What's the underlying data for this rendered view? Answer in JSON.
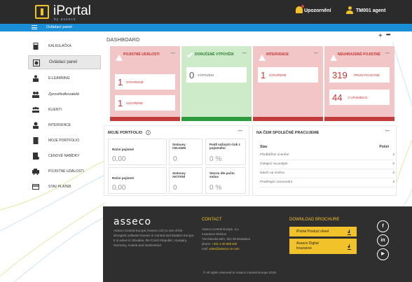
{
  "header": {
    "app_name": "iPortal",
    "brand_sub": "by asseco",
    "notifications_label": "Upozornění",
    "user_label": "TM001 agent"
  },
  "breadcrumb": {
    "current": "Ovládací panel"
  },
  "sidebar": {
    "items": [
      {
        "label": "KALKULAČKA",
        "icon": "calculator-icon"
      },
      {
        "label": "Ovládací panel",
        "icon": "dashboard-icon",
        "active": true
      },
      {
        "label": "E-LEARNING",
        "icon": "elearning-icon"
      },
      {
        "label": "Zprostředkovatelé",
        "icon": "intermediaries-icon"
      },
      {
        "label": "KLIENTI",
        "icon": "clients-icon"
      },
      {
        "label": "INTERVENCE",
        "icon": "intervention-icon"
      },
      {
        "label": "MOJE PORTFOLIO",
        "icon": "portfolio-icon"
      },
      {
        "label": "CENOVÉ NABÍDKY",
        "icon": "quotes-icon"
      },
      {
        "label": "POJISTNÉ UDÁLOSTI",
        "icon": "claims-icon"
      },
      {
        "label": "STAV PLATEB",
        "icon": "payments-icon"
      }
    ]
  },
  "dashboard": {
    "title": "DASHBOARD",
    "add_symbol": "+",
    "more_symbol": "•••"
  },
  "cards": [
    {
      "title": "POJISTNÉ UDÁLOSTI",
      "status": "warning",
      "color": "#f2c6c6",
      "bar_color": "#c43b3b",
      "rows": [
        {
          "count": "1",
          "label": "OTEVŘENÉ"
        },
        {
          "count": "1",
          "label": "UZAVŘENÉ"
        }
      ]
    },
    {
      "title": "DORUČENÉ VÝPOVĚDI",
      "status": "ok",
      "color": "#cdebc8",
      "bar_color": "#2e9b3e",
      "rows": [
        {
          "count": "0",
          "label": "VÝPOVĚDI"
        }
      ]
    },
    {
      "title": "INTERVENCE",
      "status": "warning",
      "color": "#f2c6c6",
      "bar_color": "#c43b3b",
      "rows": [
        {
          "count": "1",
          "label": "OTEVŘENÉ"
        }
      ]
    },
    {
      "title": "NEUHRAZENÉ POJISTNÉ",
      "status": "warning",
      "color": "#f2c6c6",
      "bar_color": "#c43b3b",
      "rows": [
        {
          "count": "319",
          "label": "PRVNÍ POJISTNÉ"
        },
        {
          "count": "44",
          "label": "V UPOMÍNCE"
        }
      ]
    }
  ],
  "portfolio": {
    "title": "MOJE PORTFOLIO",
    "boxes": [
      {
        "label": "Roční pojistné",
        "value": "0,00"
      },
      {
        "label": "Smlouvy CELKEM",
        "value": "0"
      },
      {
        "label": "Podíl vážných rizik z pojistného",
        "value": "0 %"
      },
      {
        "label": "Roční pojistné",
        "value": "0,00"
      },
      {
        "label": "Smlouvy AKTIVNÍ",
        "value": "0"
      },
      {
        "label": "Storno dle počtu smluv",
        "value": "0 %"
      }
    ]
  },
  "shared_work": {
    "title": "NA ČEM SPOLEČNĚ PRACUJEME",
    "col_state": "Stav",
    "col_count": "Počet",
    "rows": [
      {
        "label": "Předběžné ocenění",
        "count": "2"
      },
      {
        "label": "Čekající na podpis",
        "count": "0"
      },
      {
        "label": "Návrh na změnu",
        "count": "2"
      },
      {
        "label": "Prolehající ocenování",
        "count": "3"
      }
    ]
  },
  "footer": {
    "logo": "asseco",
    "about": "Asseco Central Europe (Asseco CE) is one of the strongest software houses in Central and Eastern Europe. It is active in Slovakia, the Czech Republic, Hungary, Germany, Austria and Switzerland.",
    "contact_title": "CONTACT",
    "contact_company": "Asseco Central Europe, a.s.",
    "contact_division": "Insurance Division",
    "contact_address": "Trenčianska 56/A, 821 09 Bratislava",
    "contact_phone_label": "phone:",
    "contact_phone": "+421 2 20 838 400",
    "contact_mail_label": "mail:",
    "contact_mail": "sales@asseco-ce.com",
    "download_title": "DOWNLOAD BROCHURE",
    "buttons": [
      "iPortal Product sheet",
      "Asseco Digital Insurance"
    ],
    "social": [
      "f",
      "in",
      "▶"
    ],
    "copyright": "© All rights reserved to Asseco Central Europe 2019"
  }
}
